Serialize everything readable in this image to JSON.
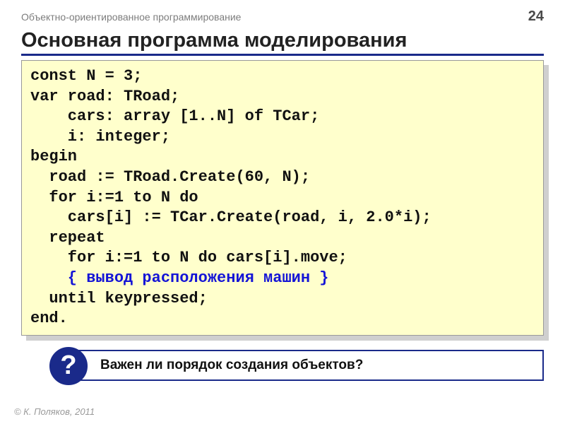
{
  "header": {
    "course": "Объектно-ориентированное программирование",
    "page": "24"
  },
  "title": "Основная программа моделирования",
  "code": {
    "l1": "const N = 3;",
    "l2": "var road: TRoad;",
    "l3": "    cars: array [1..N] of TCar;",
    "l4": "    i: integer;",
    "l5": "begin",
    "l6": "  road := TRoad.Create(60, N);",
    "l7": "  for i:=1 to N do",
    "l8": "    cars[i] := TCar.Create(road, i, 2.0*i);",
    "l9": "  repeat",
    "l10": "    for i:=1 to N do cars[i].move;",
    "l11": "    { вывод расположения машин }",
    "l12": "  until keypressed;",
    "l13": "end."
  },
  "question": {
    "badge": "?",
    "text": "Важен ли порядок создания объектов?"
  },
  "footer": "© К. Поляков, 2011"
}
